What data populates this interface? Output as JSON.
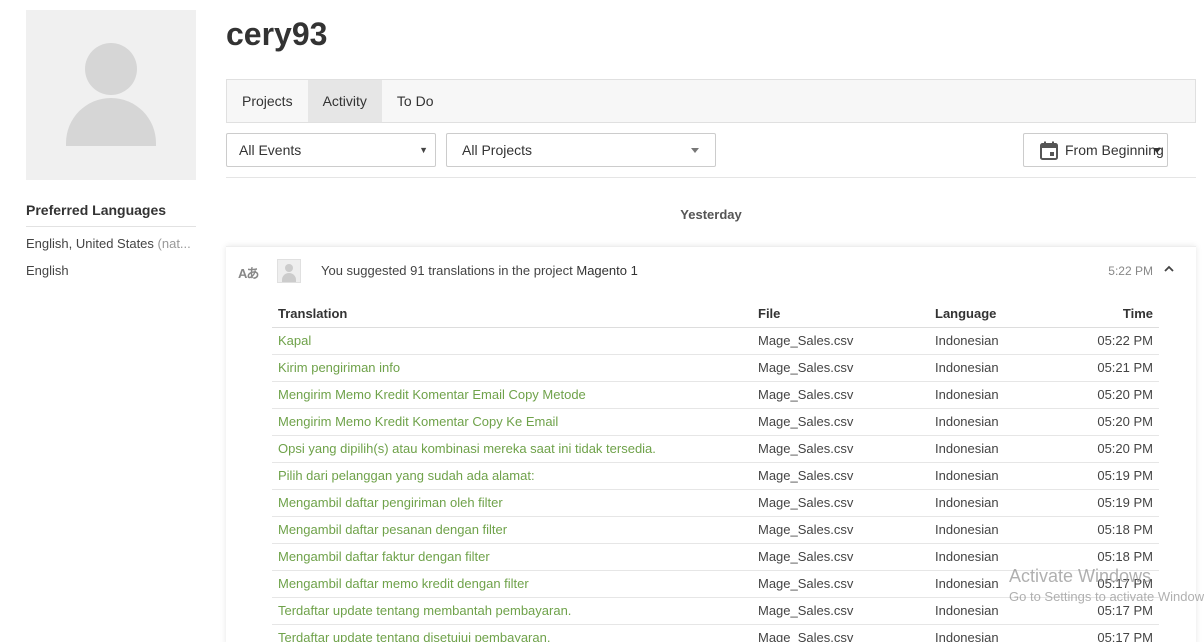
{
  "profile": {
    "username": "cery93",
    "preferred_languages_title": "Preferred Languages",
    "languages": [
      {
        "name": "English, United States",
        "note": "(nat..."
      },
      {
        "name": "English",
        "note": ""
      }
    ]
  },
  "tabs": [
    {
      "label": "Projects",
      "active": false
    },
    {
      "label": "Activity",
      "active": true
    },
    {
      "label": "To Do",
      "active": false
    }
  ],
  "filters": {
    "events": "All Events",
    "projects": "All Projects",
    "date": "From Beginning"
  },
  "day_label": "Yesterday",
  "activity": {
    "text": "You suggested 91 translations in the project",
    "project": "Magento 1",
    "time": "5:22 PM",
    "columns": {
      "translation": "Translation",
      "file": "File",
      "language": "Language",
      "time": "Time"
    },
    "rows": [
      {
        "translation": "Kapal",
        "file": "Mage_Sales.csv",
        "language": "Indonesian",
        "time": "05:22 PM"
      },
      {
        "translation": "Kirim pengiriman info",
        "file": "Mage_Sales.csv",
        "language": "Indonesian",
        "time": "05:21 PM"
      },
      {
        "translation": "Mengirim Memo Kredit Komentar Email Copy Metode",
        "file": "Mage_Sales.csv",
        "language": "Indonesian",
        "time": "05:20 PM"
      },
      {
        "translation": "Mengirim Memo Kredit Komentar Copy Ke Email",
        "file": "Mage_Sales.csv",
        "language": "Indonesian",
        "time": "05:20 PM"
      },
      {
        "translation": "Opsi yang dipilih(s) atau kombinasi mereka saat ini tidak tersedia.",
        "file": "Mage_Sales.csv",
        "language": "Indonesian",
        "time": "05:20 PM"
      },
      {
        "translation": "Pilih dari pelanggan yang sudah ada alamat:",
        "file": "Mage_Sales.csv",
        "language": "Indonesian",
        "time": "05:19 PM"
      },
      {
        "translation": "Mengambil daftar pengiriman oleh filter",
        "file": "Mage_Sales.csv",
        "language": "Indonesian",
        "time": "05:19 PM"
      },
      {
        "translation": "Mengambil daftar pesanan dengan filter",
        "file": "Mage_Sales.csv",
        "language": "Indonesian",
        "time": "05:18 PM"
      },
      {
        "translation": "Mengambil daftar faktur dengan filter",
        "file": "Mage_Sales.csv",
        "language": "Indonesian",
        "time": "05:18 PM"
      },
      {
        "translation": "Mengambil daftar memo kredit dengan filter",
        "file": "Mage_Sales.csv",
        "language": "Indonesian",
        "time": "05:17 PM"
      },
      {
        "translation": "Terdaftar update tentang membantah pembayaran.",
        "file": "Mage_Sales.csv",
        "language": "Indonesian",
        "time": "05:17 PM"
      },
      {
        "translation": "Terdaftar update tentang disetujui pembayaran.",
        "file": "Mage_Sales.csv",
        "language": "Indonesian",
        "time": "05:17 PM"
      }
    ]
  },
  "watermark": {
    "title": "Activate Windows",
    "subtitle": "Go to Settings to activate Windows."
  },
  "colors": {
    "link": "#6fa24a",
    "active_tab": "#e6e6e6"
  }
}
